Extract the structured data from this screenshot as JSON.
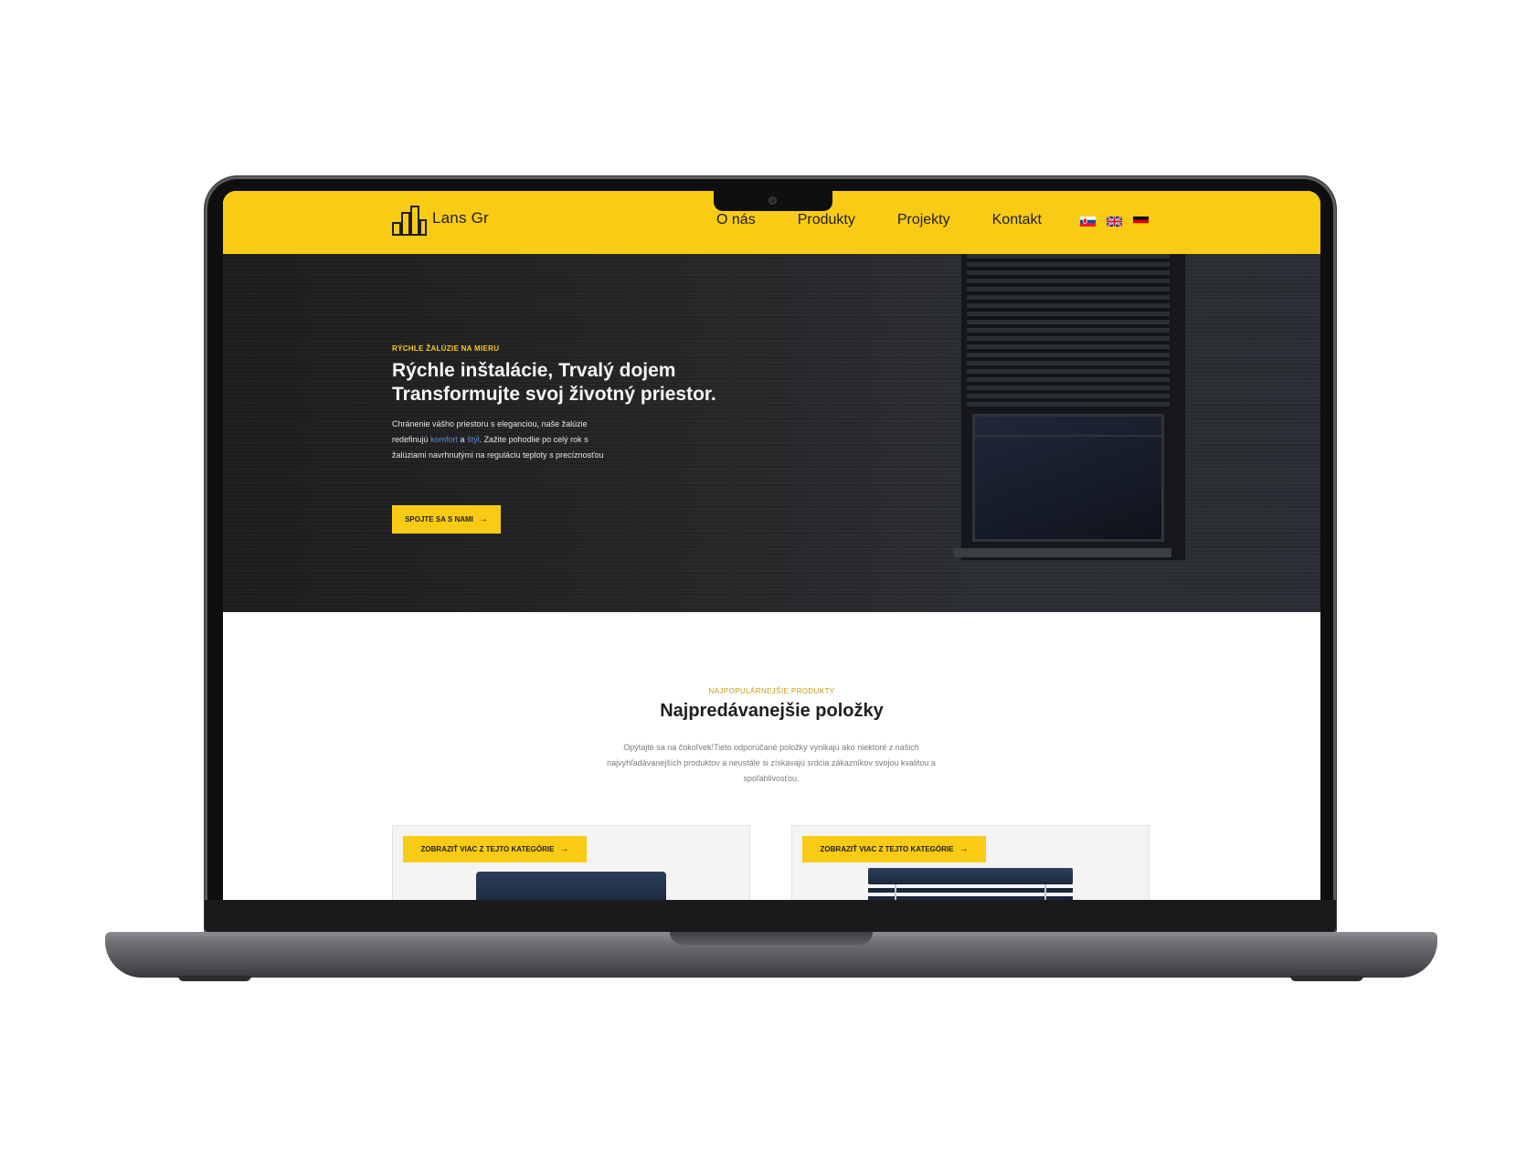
{
  "brand": {
    "name": "Lans Gr",
    "accent_color": "#f9cb14",
    "dark_color": "#1f1f1f",
    "link_color": "#5b8ad6"
  },
  "header": {
    "logo_icon": "building-bars-icon",
    "nav": [
      {
        "label": "O nás"
      },
      {
        "label": "Produkty"
      },
      {
        "label": "Projekty"
      },
      {
        "label": "Kontakt"
      }
    ],
    "languages": [
      {
        "icon": "flag-slovakia-icon"
      },
      {
        "icon": "flag-uk-icon"
      },
      {
        "icon": "flag-germany-icon"
      }
    ]
  },
  "hero": {
    "eyebrow": "RÝCHLE ŽALÚZIE NA MIERU",
    "title": "Rýchle inštalácie, Trvalý dojem Transformujte svoj životný priestor.",
    "text_before": "Chránenie vášho priestoru s eleganciou, naše žalúzie redefinujú ",
    "link_comfort": "komfort",
    "text_and": " a ",
    "link_style": "štýl",
    "text_after": ". Zažite pohodlie po celý rok s žalúziami navrhnutými na reguláciu teploty s precíznosťou",
    "cta_label": "SPOJTE SA S NAMI",
    "cta_icon": "arrow-right-icon"
  },
  "products": {
    "eyebrow": "NAJPOPULÁRNEJŠIE PRODUKTY",
    "title": "Najpredávanejšie položky",
    "text": "Opýtajte sa na čokoľvek!Tieto odporúčané položky vynikajú ako niektoré z našich najvyhľadávanejších produktov a neustále si získavajú srdcia zákazníkov svojou kvalitou a spoľahlivosťou.",
    "cards": [
      {
        "button_label": "ZOBRAZIŤ VIAC Z TEJTO KATEGÓRIE",
        "image": "roller-blind-image"
      },
      {
        "button_label": "ZOBRAZIŤ VIAC Z TEJTO KATEGÓRIE",
        "image": "venetian-blind-image"
      }
    ]
  }
}
